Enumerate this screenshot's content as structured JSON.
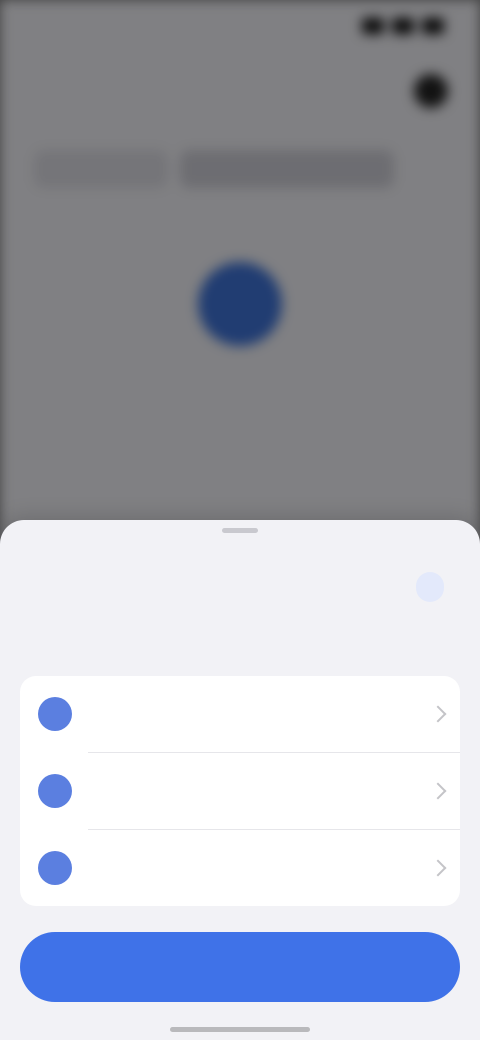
{
  "status_bar": {
    "time": "",
    "icons": [
      "signal-icon",
      "wifi-icon",
      "battery-icon"
    ]
  },
  "background_screen": {
    "header_title": "",
    "header_button_icon": "more-icon",
    "tabs": [
      {
        "label": ""
      },
      {
        "label": ""
      }
    ],
    "empty_state": {
      "title": "",
      "subtitle": ""
    }
  },
  "sheet": {
    "title": "",
    "action_label": "",
    "section_label": "",
    "items": [
      {
        "label": "",
        "color": "#d9a8e8"
      },
      {
        "label": "",
        "color": "#a8d4f5"
      },
      {
        "label": "",
        "color": "#a8e6a3"
      }
    ],
    "primary_button_label": ""
  },
  "colors": {
    "accent": "#3f72e8",
    "sheet_bg": "#f2f2f6",
    "card_bg": "#ffffff"
  }
}
